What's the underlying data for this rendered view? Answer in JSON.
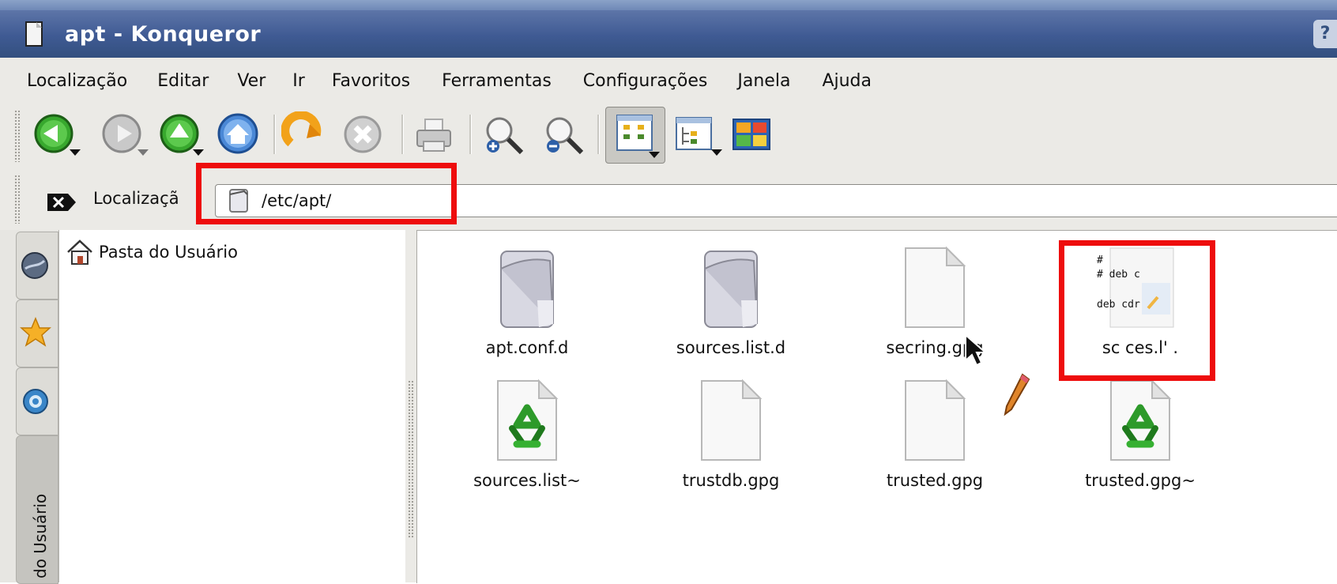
{
  "window": {
    "title": "apt - Konqueror",
    "help_label": "?"
  },
  "menu": [
    "Localização",
    "Editar",
    "Ver",
    "Ir",
    "Favoritos",
    "Ferramentas",
    "Configurações",
    "Janela",
    "Ajuda"
  ],
  "toolbar": {
    "icons": [
      "back-icon",
      "forward-icon",
      "up-icon",
      "home-icon",
      "reload-icon",
      "stop-icon",
      "print-icon",
      "zoom-in-icon",
      "zoom-out-icon",
      "icon-view-icon",
      "tree-view-icon",
      "thumbnail-view-icon"
    ]
  },
  "location": {
    "label": "Localizaçã",
    "value": "/etc/apt/"
  },
  "sidebar": {
    "vertical_tab_label": "do Usuário"
  },
  "tree": {
    "root_label": "Pasta do Usuário"
  },
  "files": [
    {
      "name": "apt.conf.d",
      "type": "folder"
    },
    {
      "name": "sources.list.d",
      "type": "folder"
    },
    {
      "name": "secring.gpg",
      "type": "file"
    },
    {
      "name": "sources.list",
      "type": "text-preview",
      "label_shown": "sc  ces.l'  .",
      "preview_lines": [
        "#",
        "# deb  c",
        "deb  cdr"
      ]
    },
    {
      "name": "sources.list~",
      "type": "recycle"
    },
    {
      "name": "trustdb.gpg",
      "type": "file"
    },
    {
      "name": "trusted.gpg",
      "type": "file"
    },
    {
      "name": "trusted.gpg~",
      "type": "recycle"
    }
  ],
  "colors": {
    "highlight": "#ee0d0d",
    "titlebar": "#3f5a93"
  }
}
